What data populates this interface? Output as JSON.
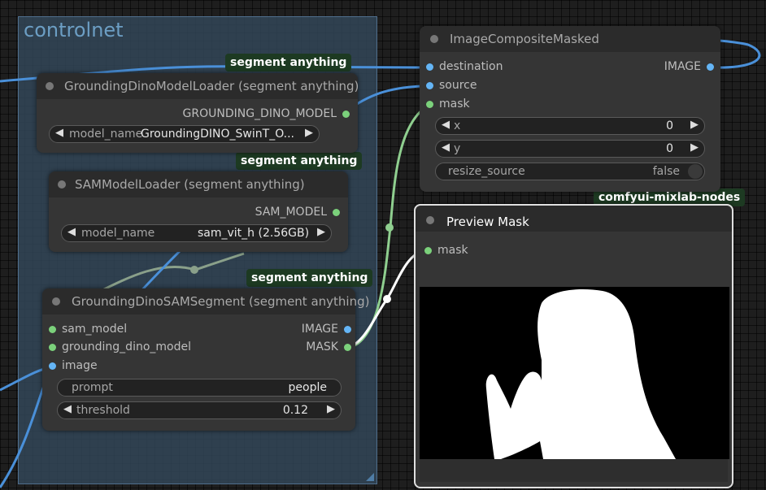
{
  "group": {
    "title": "controlnet"
  },
  "colors": {
    "canvas": "#1e1e1e",
    "group_bg": "#344a5e",
    "group_title": "#6c9ec4",
    "node_bg": "#353535",
    "node_header": "#2b2b2b",
    "tag_bg": "#1d3a22",
    "link_blue": "#4a90d9",
    "link_green": "#8fcf8f",
    "link_gray": "#8aa08a",
    "link_white": "#ffffff",
    "slot_green": "#7bd17b",
    "slot_blue": "#64b5f6"
  },
  "tags": {
    "t1": "segment anything",
    "t2": "segment anything",
    "t3": "segment anything",
    "t4": "comfyui-mixlab-nodes"
  },
  "nodes": {
    "grounding_dino_loader": {
      "title": "GroundingDinoModelLoader (segment anything)",
      "output": "GROUNDING_DINO_MODEL",
      "widget_label": "model_name",
      "widget_value": "GroundingDINO_SwinT_O..."
    },
    "sam_loader": {
      "title": "SAMModelLoader (segment anything)",
      "output": "SAM_MODEL",
      "widget_label": "model_name",
      "widget_value": "sam_vit_h (2.56GB)"
    },
    "sam_segment": {
      "title": "GroundingDinoSAMSegment (segment anything)",
      "inputs": [
        "sam_model",
        "grounding_dino_model",
        "image"
      ],
      "outputs": [
        "IMAGE",
        "MASK"
      ],
      "prompt_label": "prompt",
      "prompt_value": "people",
      "threshold_label": "threshold",
      "threshold_value": "0.12"
    },
    "composite": {
      "title": "ImageCompositeMasked",
      "inputs": [
        "destination",
        "source",
        "mask"
      ],
      "output": "IMAGE",
      "x_label": "x",
      "x_value": "0",
      "y_label": "y",
      "y_value": "0",
      "resize_label": "resize_source",
      "resize_value": "false"
    },
    "preview_mask": {
      "title": "Preview Mask",
      "input": "mask"
    }
  },
  "icons": {
    "left_arrow": "◀",
    "right_arrow": "▶"
  }
}
